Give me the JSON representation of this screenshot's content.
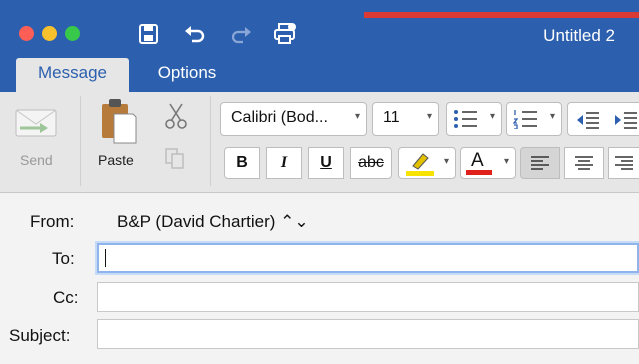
{
  "window": {
    "title": "Untitled 2"
  },
  "tabs": [
    {
      "label": "Message",
      "active": true
    },
    {
      "label": "Options",
      "active": false
    }
  ],
  "ribbon": {
    "send_label": "Send",
    "paste_label": "Paste",
    "font_family": "Calibri (Bod...",
    "font_size": "11",
    "bold_label": "B",
    "italic_label": "I",
    "underline_label": "U",
    "strike_label": "abc",
    "font_color_label": "A"
  },
  "compose": {
    "from_label": "From:",
    "from_value": "B&P (David Chartier) ⌃⌄",
    "to_label": "To:",
    "to_value": "",
    "cc_label": "Cc:",
    "cc_value": "",
    "subject_label": "Subject:",
    "subject_value": ""
  },
  "colors": {
    "titlebar": "#2c60ae",
    "highlight": "#f7e200",
    "font_color": "#e0201b"
  },
  "icons": [
    "save-icon",
    "undo-icon",
    "redo-icon",
    "print-icon",
    "send-icon",
    "paste-icon",
    "cut-icon",
    "copy-icon",
    "bullets-icon",
    "numbering-icon",
    "decrease-indent-icon",
    "increase-indent-icon",
    "highlighter-icon",
    "align-left-icon",
    "align-center-icon",
    "align-right-icon"
  ]
}
